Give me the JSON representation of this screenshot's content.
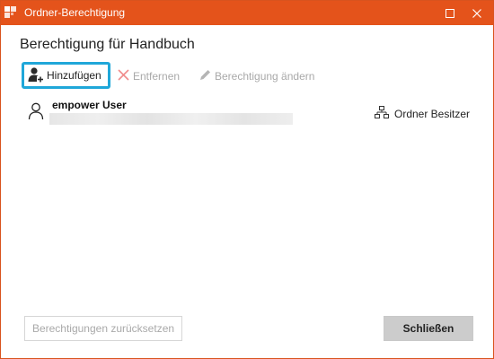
{
  "window": {
    "title": "Ordner-Berechtigung",
    "accent_color": "#e4531b"
  },
  "dialog": {
    "heading": "Berechtigung für Handbuch"
  },
  "toolbar": {
    "add_label": "Hinzufügen",
    "remove_label": "Entfernen",
    "edit_label": "Berechtigung ändern",
    "focus_color": "#1fa7d9"
  },
  "permissions": [
    {
      "name": "empower User",
      "email_redacted": true,
      "role_label": "Ordner Besitzer",
      "icon": "user-icon",
      "role_icon": "hierarchy-icon"
    }
  ],
  "footer": {
    "reset_label": "Berechtigungen zurücksetzen",
    "close_label": "Schließen"
  }
}
